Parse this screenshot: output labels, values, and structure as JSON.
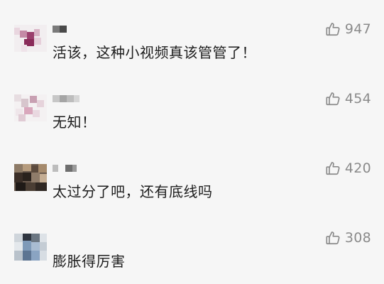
{
  "comments": [
    {
      "text": "活该，这种小视频真该管管了！",
      "likes": "947",
      "like_icon": "thumbs-up-icon"
    },
    {
      "text": "无知！",
      "likes": "454",
      "like_icon": "thumbs-up-icon"
    },
    {
      "text": "太过分了吧，还有底线吗",
      "likes": "420",
      "like_icon": "thumbs-up-icon"
    },
    {
      "text": "膨胀得厉害",
      "likes": "308",
      "like_icon": "thumbs-up-icon"
    }
  ],
  "colors": {
    "background": "#f6f6f6",
    "text": "#1d1d1d",
    "like_count": "#8a8a8a"
  }
}
